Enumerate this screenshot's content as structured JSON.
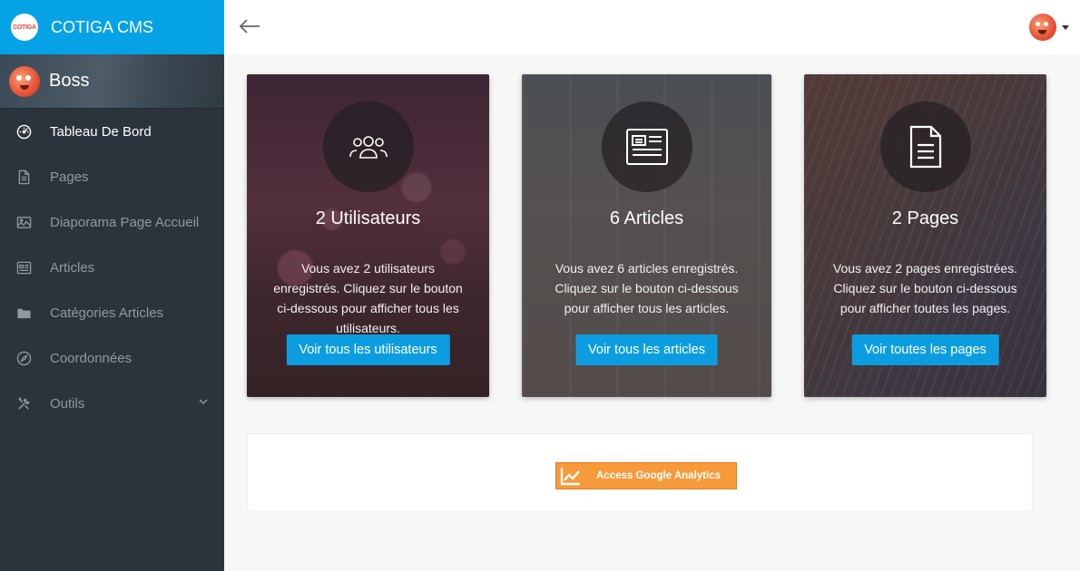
{
  "brand": {
    "logo_text": "COTIGA",
    "title": "COTIGA CMS"
  },
  "profile": {
    "name": "Boss"
  },
  "nav": [
    {
      "label": "Tableau De Bord",
      "icon": "dashboard-icon",
      "active": true
    },
    {
      "label": "Pages",
      "icon": "page-icon"
    },
    {
      "label": "Diaporama Page Accueil",
      "icon": "image-icon"
    },
    {
      "label": "Articles",
      "icon": "article-icon"
    },
    {
      "label": "Catégories Articles",
      "icon": "folder-icon"
    },
    {
      "label": "Coordonnées",
      "icon": "compass-icon"
    },
    {
      "label": "Outils",
      "icon": "tools-icon",
      "has_submenu": true
    }
  ],
  "cards": [
    {
      "icon": "users-icon",
      "title": "2 Utilisateurs",
      "text": "Vous avez 2 utilisateurs enregistrés. Cliquez sur le bouton ci-dessous pour afficher tous les utilisateurs.",
      "button": "Voir tous les utilisateurs"
    },
    {
      "icon": "newspaper-icon",
      "title": "6 Articles",
      "text": "Vous avez 6 articles enregistrés. Cliquez sur le bouton ci-dessous pour afficher tous les articles.",
      "button": "Voir tous les articles"
    },
    {
      "icon": "document-icon",
      "title": "2 Pages",
      "text": "Vous avez 2 pages enregistrées. Cliquez sur le bouton ci-dessous pour afficher toutes les pages.",
      "button": "Voir toutes les pages"
    }
  ],
  "analytics": {
    "button": "Access Google Analytics"
  },
  "colors": {
    "accent": "#05a3e5",
    "sidebar": "#2b343c",
    "button": "#0c9de0",
    "analytics": "#f79a3a"
  }
}
